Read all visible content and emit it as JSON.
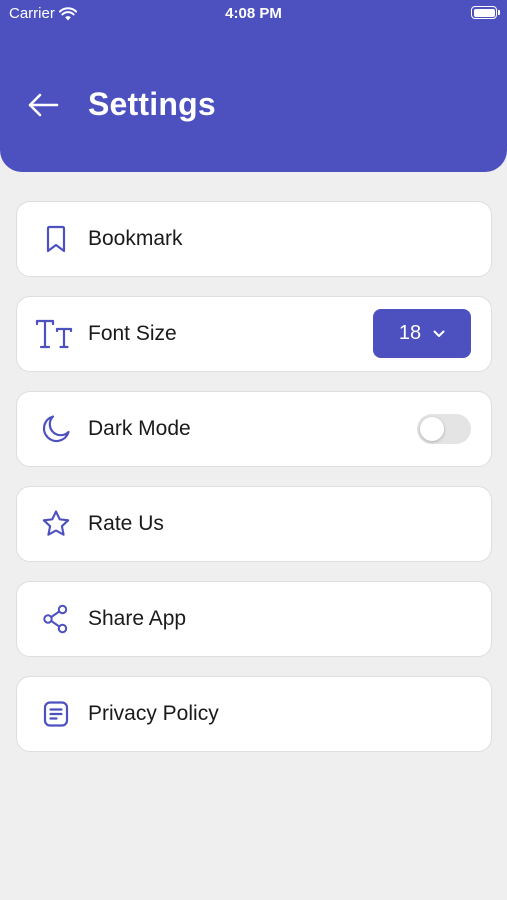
{
  "status_bar": {
    "carrier": "Carrier",
    "time": "4:08 PM"
  },
  "header": {
    "title": "Settings",
    "back_icon": "arrow-left-icon"
  },
  "colors": {
    "accent": "#4d51bf",
    "background": "#efefef",
    "card": "#ffffff",
    "toggle_off": "#e4e4e4"
  },
  "menu": {
    "bookmark": {
      "label": "Bookmark",
      "icon": "bookmark-icon"
    },
    "font_size": {
      "label": "Font Size",
      "icon": "text-size-icon",
      "value": "18"
    },
    "dark_mode": {
      "label": "Dark Mode",
      "icon": "moon-icon",
      "enabled": false
    },
    "rate_us": {
      "label": "Rate Us",
      "icon": "star-icon"
    },
    "share_app": {
      "label": "Share App",
      "icon": "share-icon"
    },
    "privacy_policy": {
      "label": "Privacy Policy",
      "icon": "document-icon"
    }
  }
}
